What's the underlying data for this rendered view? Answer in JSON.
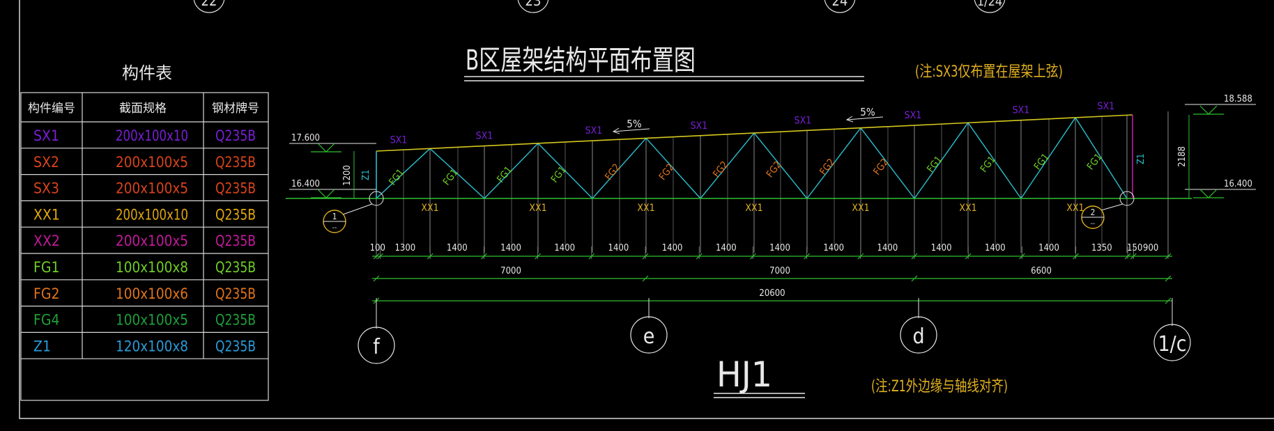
{
  "title": "B区屋架结构平面布置图",
  "truss_name": "HJ1",
  "note_top": "(注:SX3仅布置在屋架上弦)",
  "note_bottom": "(注:Z1外边缘与轴线对齐)",
  "table": {
    "title": "构件表",
    "headers": [
      "构件编号",
      "截面规格",
      "钢材牌号"
    ],
    "rows": [
      {
        "id": "SX1",
        "section": "200x100x10",
        "grade": "Q235B",
        "color": "#7a1fd6"
      },
      {
        "id": "SX2",
        "section": "200x100x5",
        "grade": "Q235B",
        "color": "#d8431b"
      },
      {
        "id": "SX3",
        "section": "200x100x5",
        "grade": "Q235B",
        "color": "#d8431b"
      },
      {
        "id": "XX1",
        "section": "200x100x10",
        "grade": "Q235B",
        "color": "#e0a80e"
      },
      {
        "id": "XX2",
        "section": "200x100x5",
        "grade": "Q235B",
        "color": "#c21a9b"
      },
      {
        "id": "FG1",
        "section": "100x100x8",
        "grade": "Q235B",
        "color": "#6fcf26"
      },
      {
        "id": "FG2",
        "section": "100x100x6",
        "grade": "Q235B",
        "color": "#e0741c"
      },
      {
        "id": "FG4",
        "section": "100x100x5",
        "grade": "Q235B",
        "color": "#1f9e3a"
      },
      {
        "id": "Z1",
        "section": "120x100x8",
        "grade": "Q235B",
        "color": "#2b9bd8"
      }
    ]
  },
  "axis_top_labels": [
    "22",
    "23",
    "24",
    "1/24"
  ],
  "axis_bottom_labels": [
    "f",
    "e",
    "d",
    "1/c"
  ],
  "elevations": {
    "left_top": "17.600",
    "left_bottom": "16.400",
    "right_top": "18.588",
    "right_bottom": "16.400"
  },
  "heights": {
    "left": "1200",
    "right": "2188"
  },
  "slope_labels": [
    "5%",
    "5%"
  ],
  "top_chord_labels": [
    "SX1",
    "SX1",
    "SX1",
    "SX1",
    "SX1",
    "SX1",
    "SX1",
    "SX1"
  ],
  "bottom_chord_labels": [
    "XX1",
    "XX1",
    "XX1",
    "XX1",
    "XX1",
    "XX1",
    "XX1"
  ],
  "web_labels": [
    "FG1",
    "FG1",
    "FG1",
    "FG1",
    "FG2",
    "FG2",
    "FG2",
    "FG2",
    "FG2",
    "FG2",
    "FG1",
    "FG1",
    "FG1",
    "FG1"
  ],
  "column_labels": [
    "Z1",
    "Z1"
  ],
  "detail_markers": [
    {
      "num": "1",
      "sub": "--"
    },
    {
      "num": "2",
      "sub": "--"
    }
  ],
  "dims_row1": [
    "100",
    "1300",
    "1400",
    "1400",
    "1400",
    "1400",
    "1400",
    "1400",
    "1400",
    "1400",
    "1400",
    "1400",
    "1400",
    "1400",
    "1350",
    "150",
    "900"
  ],
  "dims_row2": [
    "7000",
    "7000",
    "6600"
  ],
  "dims_row3": [
    "20600"
  ],
  "colors": {
    "top_chord": "#d4c81e",
    "bottom_chord": "#2fc12f",
    "web": "#2bbfcf",
    "dimension": "#2fc12f",
    "white": "#e8e8e8",
    "note": "#e0b020"
  }
}
